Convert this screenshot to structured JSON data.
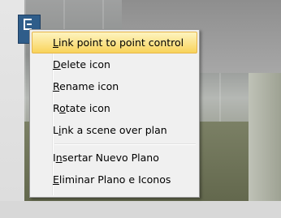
{
  "context_menu": {
    "items": [
      {
        "prefix": "",
        "mnemonic": "L",
        "rest": "ink point to point control",
        "highlighted": true
      },
      {
        "prefix": "",
        "mnemonic": "D",
        "rest": "elete icon",
        "highlighted": false
      },
      {
        "prefix": "",
        "mnemonic": "R",
        "rest": "ename icon",
        "highlighted": false
      },
      {
        "prefix": "R",
        "mnemonic": "o",
        "rest": "tate icon",
        "highlighted": false
      },
      {
        "prefix": "L",
        "mnemonic": "i",
        "rest": "nk a scene over plan",
        "highlighted": false
      }
    ],
    "secondary_items": [
      {
        "prefix": "I",
        "mnemonic": "n",
        "rest": "sertar Nuevo Plano",
        "highlighted": false
      },
      {
        "prefix": "",
        "mnemonic": "E",
        "rest": "liminar Plano e Iconos",
        "highlighted": false
      }
    ]
  },
  "icons": {
    "plan_icon": "plan-marker-icon"
  },
  "colors": {
    "highlight_top": "#fdf4bf",
    "highlight_bottom": "#f8d35a",
    "highlight_border": "#e6b54a",
    "menu_background": "#f0f0f0",
    "plan_icon": "#2f5d8a"
  }
}
